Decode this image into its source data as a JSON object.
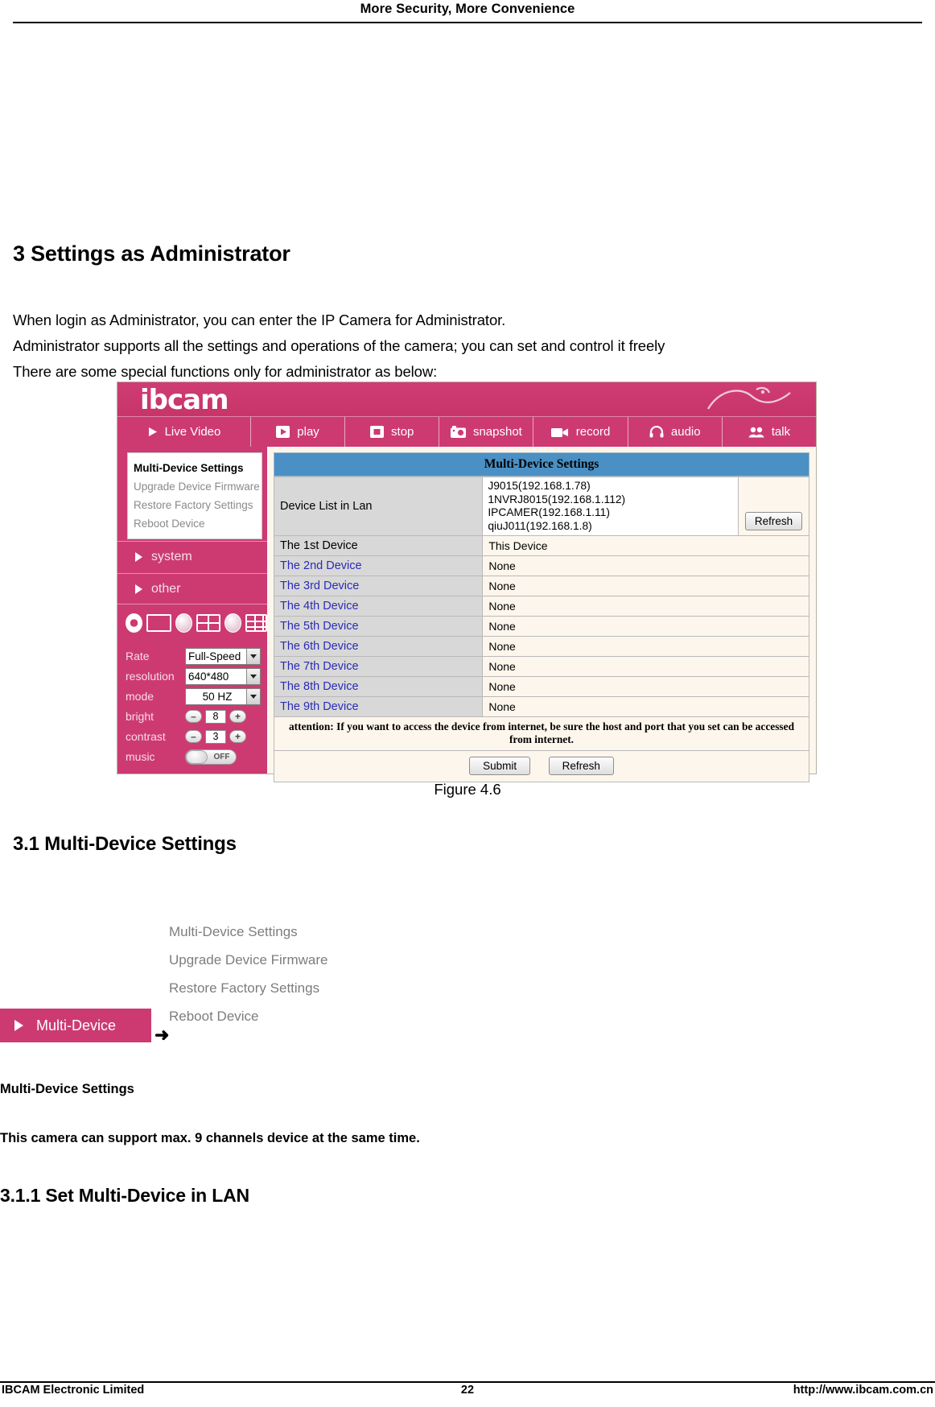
{
  "header": {
    "title": "More Security, More Convenience"
  },
  "section": {
    "heading": "3 Settings as Administrator",
    "paragraph_lines": [
      "When login as Administrator, you can enter the IP Camera for Administrator.",
      "Administrator supports all the settings and operations of the camera; you can set and control it freely",
      "There are some special functions only for administrator as below:"
    ]
  },
  "figure": {
    "caption": "Figure 4.6",
    "logo": "ibcam",
    "toolbar": [
      {
        "label": "Live Video",
        "icon": "play-triangle-icon"
      },
      {
        "label": "play",
        "icon": "play-icon"
      },
      {
        "label": "stop",
        "icon": "stop-icon"
      },
      {
        "label": "snapshot",
        "icon": "camera-icon"
      },
      {
        "label": "record",
        "icon": "video-camera-icon"
      },
      {
        "label": "audio",
        "icon": "headphone-icon"
      },
      {
        "label": "talk",
        "icon": "people-icon"
      }
    ],
    "sidebar": {
      "menu": [
        "Multi-Device Settings",
        "Upgrade Device Firmware",
        "Restore Factory Settings",
        "Reboot Device"
      ],
      "active_menu": "Multi-Device Settings",
      "groups": [
        "system",
        "other"
      ],
      "controls": {
        "rate_label": "Rate",
        "rate_value": "Full-Speed",
        "resolution_label": "resolution",
        "resolution_value": "640*480",
        "mode_label": "mode",
        "mode_value": "50 HZ",
        "bright_label": "bright",
        "bright_value": "8",
        "contrast_label": "contrast",
        "contrast_value": "3",
        "music_label": "music",
        "music_state": "OFF",
        "minus": "–",
        "plus": "+"
      }
    },
    "panel": {
      "title": "Multi-Device Settings",
      "device_list_label": "Device List in Lan",
      "device_list": [
        "J9015(192.168.1.78)",
        "1NVRJ8015(192.168.1.112)",
        "IPCAMER(192.168.1.11)",
        "qiuJ011(192.168.1.8)"
      ],
      "refresh_label": "Refresh",
      "rows": [
        {
          "label": "The 1st Device",
          "value": "This Device",
          "label_plain": true
        },
        {
          "label": "The 2nd Device",
          "value": "None",
          "label_plain": false
        },
        {
          "label": "The 3rd Device",
          "value": "None",
          "label_plain": false
        },
        {
          "label": "The 4th Device",
          "value": "None",
          "label_plain": false
        },
        {
          "label": "The 5th Device",
          "value": "None",
          "label_plain": false
        },
        {
          "label": "The 6th Device",
          "value": "None",
          "label_plain": false
        },
        {
          "label": "The 7th Device",
          "value": "None",
          "label_plain": false
        },
        {
          "label": "The 8th Device",
          "value": "None",
          "label_plain": false
        },
        {
          "label": "The 9th Device",
          "value": "None",
          "label_plain": false
        }
      ],
      "attention": "attention: If you want to access the device from internet, be sure the host and port that you set can be accessed from internet.",
      "submit_label": "Submit",
      "refresh_bottom_label": "Refresh"
    }
  },
  "subsection": {
    "heading": "3.1 Multi-Device Settings",
    "nav_menu": [
      "Multi-Device Settings",
      "Upgrade Device Firmware",
      "Restore Factory Settings",
      "Reboot Device"
    ],
    "nav_button_label": "Multi-Device",
    "arrow": "➜",
    "bold_line_1": "Multi-Device Settings",
    "bold_line_2": "This camera can support max. 9 channels device at the same time.",
    "subsubsection_heading": "3.1.1 Set Multi-Device in LAN"
  },
  "footer": {
    "left": "IBCAM Electronic Limited",
    "center": "22",
    "right": "http://www.ibcam.com.cn"
  },
  "colors": {
    "brand_pink": "#cd3a72",
    "panel_blue": "#4a90c4",
    "link_blue": "#2b2bb5",
    "cream": "#fdf6ec"
  }
}
